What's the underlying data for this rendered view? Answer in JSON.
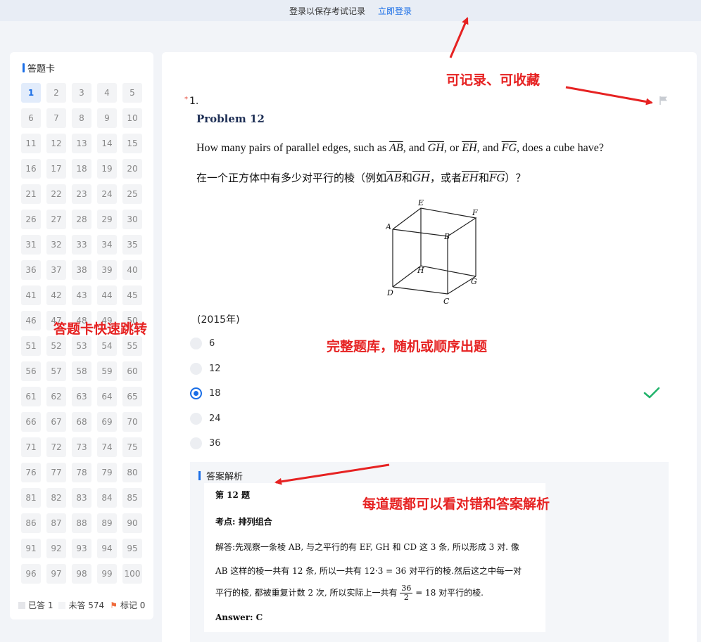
{
  "topbar": {
    "message": "登录以保存考试记录",
    "login_link": "立即登录"
  },
  "answer_card": {
    "title": "答题卡",
    "cells": [
      "1",
      "2",
      "3",
      "4",
      "5",
      "6",
      "7",
      "8",
      "9",
      "10",
      "11",
      "12",
      "13",
      "14",
      "15",
      "16",
      "17",
      "18",
      "19",
      "20",
      "21",
      "22",
      "23",
      "24",
      "25",
      "26",
      "27",
      "28",
      "29",
      "30",
      "31",
      "32",
      "33",
      "34",
      "35",
      "36",
      "37",
      "38",
      "39",
      "40",
      "41",
      "42",
      "43",
      "44",
      "45",
      "46",
      "47",
      "48",
      "49",
      "50",
      "51",
      "52",
      "53",
      "54",
      "55",
      "56",
      "57",
      "58",
      "59",
      "60",
      "61",
      "62",
      "63",
      "64",
      "65",
      "66",
      "67",
      "68",
      "69",
      "70",
      "71",
      "72",
      "73",
      "74",
      "75",
      "76",
      "77",
      "78",
      "79",
      "80",
      "81",
      "82",
      "83",
      "84",
      "85",
      "86",
      "87",
      "88",
      "89",
      "90",
      "91",
      "92",
      "93",
      "94",
      "95",
      "96",
      "97",
      "98",
      "99",
      "100"
    ],
    "active_cell": "1",
    "legend": {
      "answered": "已答 1",
      "unanswered": "未答 574",
      "marked": "标记 0"
    }
  },
  "question": {
    "number": "1.",
    "problem_title": "Problem 12",
    "en": {
      "pre": "How many pairs of parallel edges, such as ",
      "ab": "AB",
      "and": ", and ",
      "gh": "GH",
      "or": ", or ",
      "eh": "EH",
      "and2": ", and ",
      "fg": "FG",
      "post": ", does a cube have?"
    },
    "cn": {
      "pre": "在一个正方体中有多少对平行的棱（例如",
      "ab": "AB",
      "he": "和",
      "gh": "GH",
      "huozhe": "，或者",
      "eh": "EH",
      "he2": "和",
      "fg": "FG",
      "post": "）？"
    },
    "cube_labels": {
      "A": "A",
      "B": "B",
      "C": "C",
      "D": "D",
      "E": "E",
      "F": "F",
      "G": "G",
      "H": "H"
    },
    "year": "(2015年)",
    "options": [
      "6",
      "12",
      "18",
      "24",
      "36"
    ],
    "selected": "18"
  },
  "analysis": {
    "title": "答案解析",
    "heading": "第 12 题",
    "kaodian": "考点: 排列组合",
    "line1": "解答:先观察一条棱 AB, 与之平行的有 EF, GH 和 CD 这 3 条, 所以形成 3 对. 像",
    "line2": "AB 这样的棱一共有 12 条, 所以一共有 12·3 = 36 对平行的棱.然后这之中每一对",
    "line3_pre": "平行的棱, 都被重复计数 2 次, 所以实际上一共有",
    "line3_num": "36",
    "line3_den": "2",
    "line3_post": "= 18 对平行的棱.",
    "answer": "Answer: C"
  },
  "annotations": {
    "record": "可记录、可收藏",
    "jump": "答题卡快速跳转",
    "bank": "完整题库，随机或顺序出题",
    "explain": "每道题都可以看对错和答案解析"
  },
  "colors": {
    "accent": "#1a6ee6",
    "annotation": "#e62222",
    "correct": "#21b36b"
  }
}
